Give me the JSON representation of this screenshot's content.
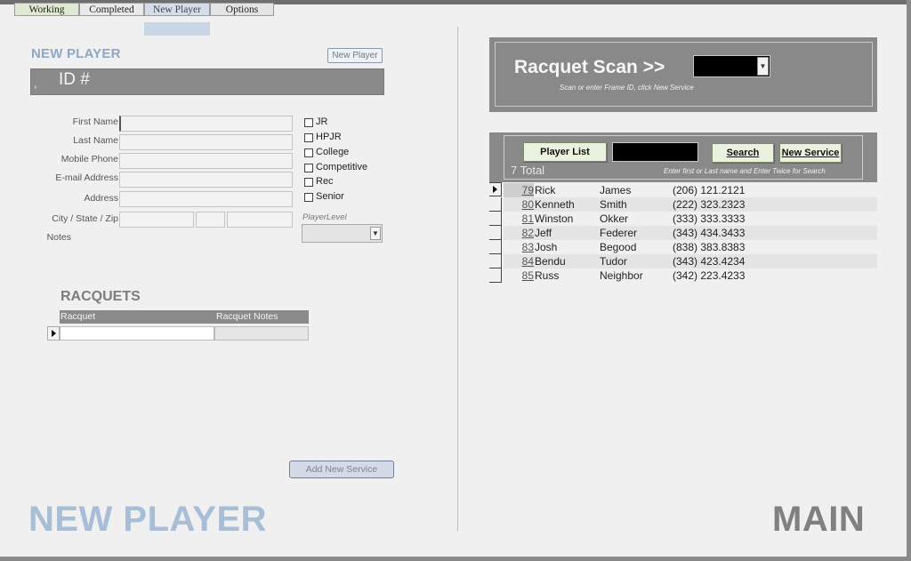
{
  "tabs": [
    {
      "label": "Working"
    },
    {
      "label": "Completed"
    },
    {
      "label": "New Player"
    },
    {
      "label": "Options"
    }
  ],
  "left": {
    "section_title": "NEW PLAYER",
    "new_player_button": "New Player",
    "id_prefix": ",",
    "id_label": "ID #",
    "fields": {
      "first_name": "First Name",
      "last_name": "Last Name",
      "mobile_phone": "Mobile Phone",
      "email": "E-mail Address",
      "address": "Address",
      "city_state_zip": "City / State / Zip",
      "notes": "Notes"
    },
    "levels": [
      "JR",
      "HPJR",
      "College",
      "Competitive",
      "Rec",
      "Senior"
    ],
    "player_level_label": "PlayerLevel",
    "racquets": {
      "title": "RACQUETS",
      "col1": "Racquet",
      "col2": "Racquet Notes"
    },
    "add_service_button": "Add New Service",
    "footer_label": "NEW PLAYER"
  },
  "right": {
    "scan_title": "Racquet Scan  >>",
    "scan_hint": "Scan or enter Frame ID, click New Service",
    "player_list_button": "Player List",
    "search_button": "Search",
    "new_service_button": "New Service",
    "total": "7 Total",
    "search_hint": "Enter first or Last name and Enter Twice for Search",
    "players": [
      {
        "id": "79",
        "first": "Rick",
        "last": "James",
        "phone": "(206) 121.2121"
      },
      {
        "id": "80",
        "first": "Kenneth",
        "last": "Smith",
        "phone": "(222) 323.2323"
      },
      {
        "id": "81",
        "first": "Winston",
        "last": "Okker",
        "phone": "(333) 333.3333"
      },
      {
        "id": "82",
        "first": "Jeff",
        "last": "Federer",
        "phone": "(343) 434.3433"
      },
      {
        "id": "83",
        "first": "Josh",
        "last": "Begood",
        "phone": "(838) 383.8383"
      },
      {
        "id": "84",
        "first": "Bendu",
        "last": "Tudor",
        "phone": "(343) 423.4234"
      },
      {
        "id": "85",
        "first": "Russ",
        "last": "Neighbor",
        "phone": "(342) 223.4233"
      }
    ],
    "footer_label": "MAIN"
  }
}
